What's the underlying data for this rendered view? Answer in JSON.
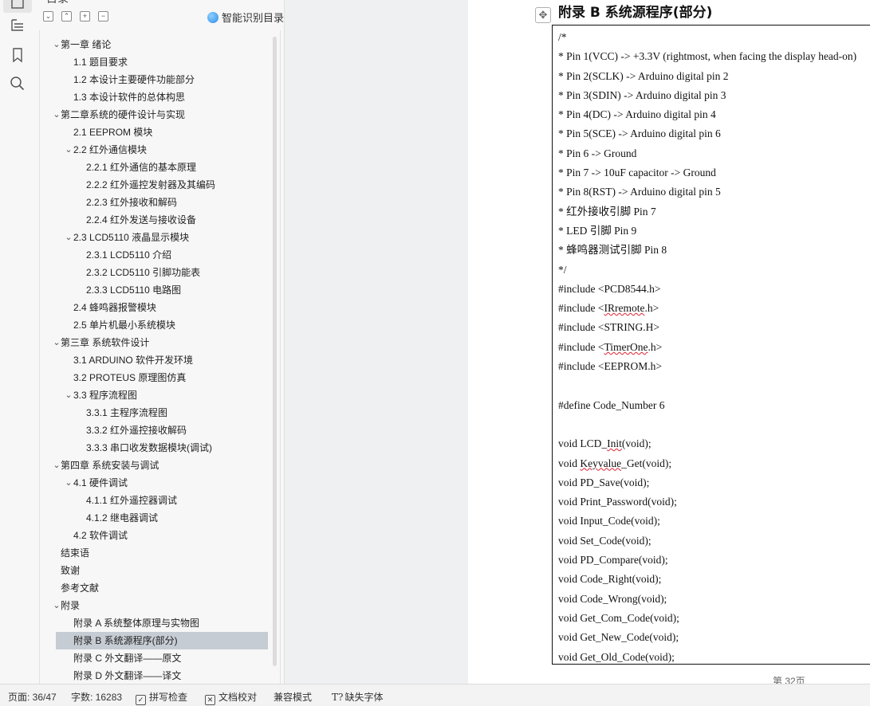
{
  "toc_panel": {
    "title": "目录",
    "smart_button": "智能识别目录",
    "items": [
      {
        "label": "第一章  绪论",
        "level": 0,
        "caret": true
      },
      {
        "label": "1.1    题目要求",
        "level": 1,
        "caret": false
      },
      {
        "label": "1.2    本设计主要硬件功能部分",
        "level": 1,
        "caret": false
      },
      {
        "label": "1.3    本设计软件的总体构思",
        "level": 1,
        "caret": false
      },
      {
        "label": "第二章系统的硬件设计与实现",
        "level": 0,
        "caret": true
      },
      {
        "label": "2.1    EEPROM 模块",
        "level": 1,
        "caret": false
      },
      {
        "label": "2.2    红外通信模块",
        "level": 1,
        "caret": true
      },
      {
        "label": "2.2.1    红外通信的基本原理",
        "level": 2,
        "caret": false
      },
      {
        "label": "2.2.2    红外遥控发射器及其编码",
        "level": 2,
        "caret": false
      },
      {
        "label": "2.2.3    红外接收和解码",
        "level": 2,
        "caret": false
      },
      {
        "label": "2.2.4    红外发送与接收设备",
        "level": 2,
        "caret": false
      },
      {
        "label": "2.3    LCD5110 液晶显示模块",
        "level": 1,
        "caret": true
      },
      {
        "label": "2.3.1    LCD5110 介绍",
        "level": 2,
        "caret": false
      },
      {
        "label": "2.3.2    LCD5110 引脚功能表",
        "level": 2,
        "caret": false
      },
      {
        "label": "2.3.3    LCD5110 电路图",
        "level": 2,
        "caret": false
      },
      {
        "label": "2.4      蜂鸣器报警模块",
        "level": 1,
        "caret": false
      },
      {
        "label": "2.5    单片机最小系统模块",
        "level": 1,
        "caret": false
      },
      {
        "label": "第三章  系统软件设计",
        "level": 0,
        "caret": true
      },
      {
        "label": "3.1    ARDUINO 软件开发环境",
        "level": 1,
        "caret": false
      },
      {
        "label": "3.2    PROTEUS 原理图仿真",
        "level": 1,
        "caret": false
      },
      {
        "label": "3.3    程序流程图",
        "level": 1,
        "caret": true
      },
      {
        "label": "3.3.1    主程序流程图",
        "level": 2,
        "caret": false
      },
      {
        "label": "3.3.2    红外遥控接收解码",
        "level": 2,
        "caret": false
      },
      {
        "label": "3.3.3    串口收发数据模块(调试)",
        "level": 2,
        "caret": false
      },
      {
        "label": "第四章  系统安装与调试",
        "level": 0,
        "caret": true
      },
      {
        "label": "4.1  硬件调试",
        "level": 1,
        "caret": true
      },
      {
        "label": "4.1.1 红外遥控器调试",
        "level": 2,
        "caret": false
      },
      {
        "label": "4.1.2 继电器调试",
        "level": 2,
        "caret": false
      },
      {
        "label": "4.2  软件调试",
        "level": 1,
        "caret": false
      },
      {
        "label": "结束语",
        "level": 0,
        "caret": false
      },
      {
        "label": "致谢",
        "level": 0,
        "caret": false
      },
      {
        "label": "参考文献",
        "level": 0,
        "caret": false
      },
      {
        "label": "附录",
        "level": 0,
        "caret": true
      },
      {
        "label": "附录 A    系统整体原理与实物图",
        "level": 1,
        "caret": false
      },
      {
        "label": "附录 B    系统源程序(部分)",
        "level": 1,
        "caret": false,
        "selected": true
      },
      {
        "label": "附录 C    外文翻译——原文",
        "level": 1,
        "caret": false
      },
      {
        "label": "附录 D    外文翻译——译文",
        "level": 1,
        "caret": false
      }
    ]
  },
  "document": {
    "appendix_title": "附录 B   系统源程序(部分)",
    "code_lines": [
      "/*",
      "  * Pin 1(VCC) -> +3.3V (rightmost, when facing the display head-on)",
      "  * Pin 2(SCLK) -> Arduino digital pin 2",
      "  * Pin 3(SDIN) -> Arduino digital pin 3",
      "  * Pin 4(DC) -> Arduino digital pin 4",
      "  * Pin 5(SCE) -> Arduino digital pin 6",
      "  * Pin 6 -> Ground",
      "  * Pin 7 -> 10uF capacitor -> Ground",
      "  * Pin 8(RST) -> Arduino digital pin 5",
      "  *  红外接收引脚  Pin    7",
      "  * LED 引脚  Pin 9",
      "  *  蜂鸣器测试引脚    Pin 8",
      "  */",
      "#include <PCD8544.h>",
      "#include <IRremote.h>",
      "#include <STRING.H>",
      "#include <TimerOne.h>",
      "#include <EEPROM.h>",
      "",
      "#define Code_Number 6",
      "",
      "void LCD_Init(void);",
      "void Keyvalue_Get(void);",
      "void PD_Save(void);",
      "void Print_Password(void);",
      "void Input_Code(void);",
      "void Set_Code(void);",
      "void PD_Compare(void);",
      "void Code_Right(void);",
      "void Code_Wrong(void);",
      "void Get_Com_Code(void);",
      "void Get_New_Code(void);",
      "void Get_Old_Code(void);"
    ],
    "page_number": "第 32页"
  },
  "status_bar": {
    "page": "页面: 36/47",
    "words": "字数: 16283",
    "spell_check": "拼写检查",
    "proofread": "文档校对",
    "compat_mode": "兼容模式",
    "missing_fonts": "缺失字体"
  }
}
